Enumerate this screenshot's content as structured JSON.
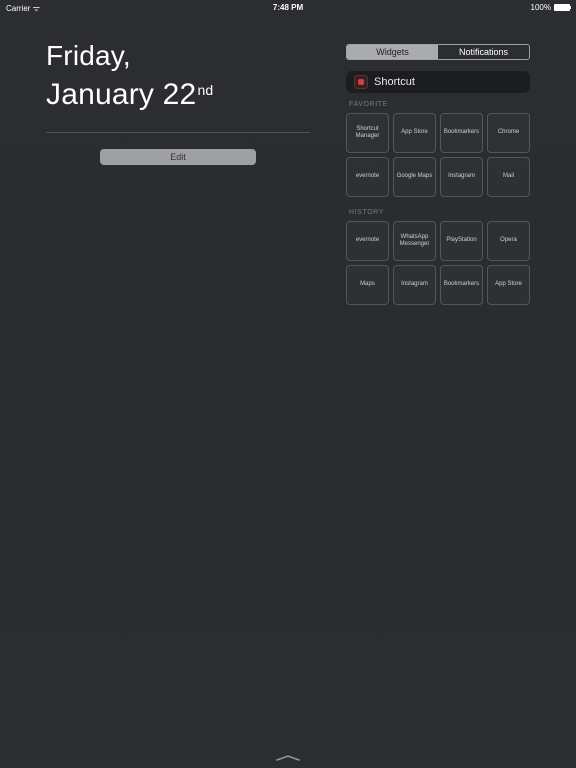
{
  "status": {
    "carrier": "Carrier",
    "time": "7:48 PM",
    "battery": "100%"
  },
  "date": {
    "day": "Friday,",
    "month_day": "January 22",
    "ordinal": "nd"
  },
  "edit_label": "Edit",
  "tabs": {
    "widgets": "Widgets",
    "notifications": "Notifications"
  },
  "widget": {
    "title": "Shortcut"
  },
  "sections": {
    "favorite": {
      "label": "FAVORITE",
      "items": [
        "Shortcut Manager",
        "App Store",
        "Bookmarkers",
        "Chrome",
        "evernote",
        "Google Maps",
        "Instagram",
        "Mail"
      ]
    },
    "history": {
      "label": "HISTORY",
      "items": [
        "evernote",
        "WhatsApp Messenger",
        "PlayStation",
        "Opera",
        "Maps",
        "Instagram",
        "Bookmarkers",
        "App Store"
      ]
    }
  }
}
